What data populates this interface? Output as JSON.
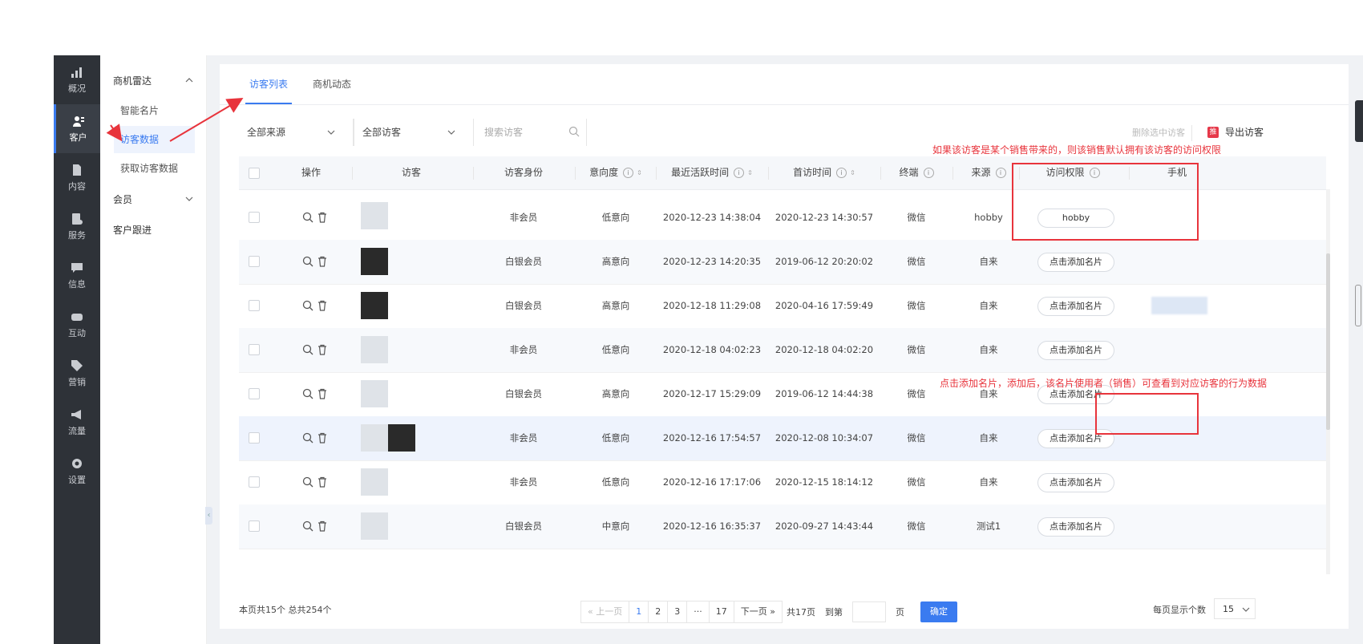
{
  "nav": [
    {
      "label": "概况",
      "icon": "chart-icon"
    },
    {
      "label": "客户",
      "icon": "users-icon"
    },
    {
      "label": "内容",
      "icon": "document-icon"
    },
    {
      "label": "服务",
      "icon": "service-icon"
    },
    {
      "label": "信息",
      "icon": "message-icon"
    },
    {
      "label": "互动",
      "icon": "gamepad-icon"
    },
    {
      "label": "营销",
      "icon": "tag-icon"
    },
    {
      "label": "流量",
      "icon": "megaphone-icon"
    },
    {
      "label": "设置",
      "icon": "gear-icon"
    }
  ],
  "subnav": {
    "group1": "商机雷达",
    "item1": "智能名片",
    "item2": "访客数据",
    "item3": "获取访客数据",
    "group2": "会员",
    "group3": "客户跟进"
  },
  "tabs": [
    "访客列表",
    "商机动态"
  ],
  "filters": {
    "source": "全部来源",
    "visitor": "全部访客",
    "search_placeholder": "搜索访客",
    "delete_selected": "删除选中访客",
    "export": "导出访客",
    "export_badge": "推"
  },
  "columns": [
    "操作",
    "访客",
    "访客身份",
    "意向度",
    "最近活跃时间",
    "首访时间",
    "终端",
    "来源",
    "访问权限",
    "手机"
  ],
  "rows": [
    {
      "identity": "非会员",
      "intent": "低意向",
      "last": "2020-12-23 14:38:04",
      "first": "2020-12-23 14:30:57",
      "terminal": "微信",
      "source": "hobby",
      "permission": "hobby"
    },
    {
      "identity": "白银会员",
      "intent": "高意向",
      "last": "2020-12-23 14:20:35",
      "first": "2019-06-12 20:20:02",
      "terminal": "微信",
      "source": "自来",
      "permission": "点击添加名片"
    },
    {
      "identity": "白银会员",
      "intent": "高意向",
      "last": "2020-12-18 11:29:08",
      "first": "2020-04-16 17:59:49",
      "terminal": "微信",
      "source": "自来",
      "permission": "点击添加名片"
    },
    {
      "identity": "非会员",
      "intent": "低意向",
      "last": "2020-12-18 04:02:23",
      "first": "2020-12-18 04:02:20",
      "terminal": "微信",
      "source": "自来",
      "permission": "点击添加名片"
    },
    {
      "identity": "白银会员",
      "intent": "高意向",
      "last": "2020-12-17 15:29:09",
      "first": "2019-06-12 14:44:38",
      "terminal": "微信",
      "source": "自来",
      "permission": "点击添加名片"
    },
    {
      "identity": "非会员",
      "intent": "低意向",
      "last": "2020-12-16 17:54:57",
      "first": "2020-12-08 10:34:07",
      "terminal": "微信",
      "source": "自来",
      "permission": "点击添加名片"
    },
    {
      "identity": "非会员",
      "intent": "低意向",
      "last": "2020-12-16 17:17:06",
      "first": "2020-12-15 18:14:12",
      "terminal": "微信",
      "source": "自来",
      "permission": "点击添加名片"
    },
    {
      "identity": "白银会员",
      "intent": "中意向",
      "last": "2020-12-16 16:35:37",
      "first": "2020-09-27 14:43:44",
      "terminal": "微信",
      "source": "测试1",
      "permission": "点击添加名片"
    }
  ],
  "footer": {
    "summary": "本页共15个  总共254个",
    "prev": "上一页",
    "pages": [
      "1",
      "2",
      "3",
      "···",
      "17"
    ],
    "next": "下一页",
    "total_pages": "共17页",
    "goto": "到第",
    "page_unit": "页",
    "ok": "确定",
    "per_page_label": "每页显示个数",
    "per_page_value": "15"
  },
  "annotations": {
    "note1": "如果该访客是某个销售带来的，则该销售默认拥有该访客的访问权限",
    "note2": "点击添加名片，添加后，该名片使用者（销售）可查看到对应访客的行为数据"
  },
  "colors": {
    "accent": "#3a7bf0",
    "annotation": "#e8343c",
    "nav_bg": "#2e3238"
  }
}
